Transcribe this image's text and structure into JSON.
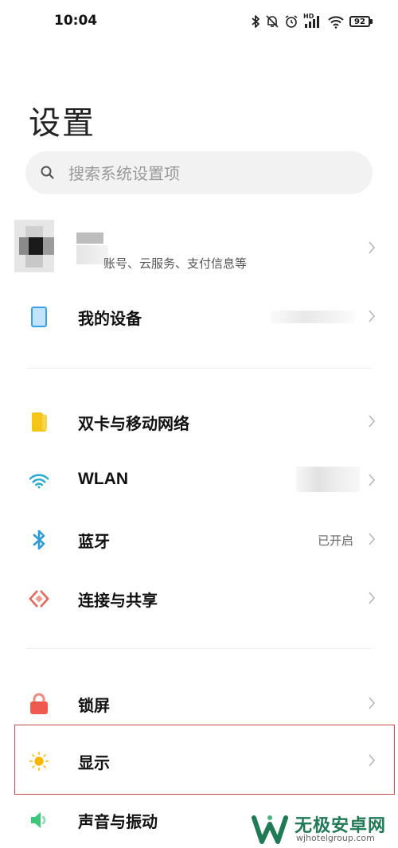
{
  "status_bar": {
    "time": "10:04",
    "battery": "92",
    "hd_label": "HD",
    "icons": [
      "bluetooth-icon",
      "mute-bell-icon",
      "alarm-icon",
      "hd-signal-icon",
      "wifi-icon",
      "battery-icon"
    ]
  },
  "page": {
    "title": "设置"
  },
  "search": {
    "placeholder": "搜索系统设置项",
    "value": ""
  },
  "account": {
    "subtitle": "账号、云服务、支付信息等"
  },
  "sections": {
    "device": {
      "label": "我的设备"
    },
    "sim": {
      "label": "双卡与移动网络"
    },
    "wlan": {
      "label": "WLAN"
    },
    "bluetooth": {
      "label": "蓝牙",
      "value": "已开启"
    },
    "connect": {
      "label": "连接与共享"
    },
    "lock": {
      "label": "锁屏"
    },
    "display": {
      "label": "显示"
    },
    "sound": {
      "label": "声音与振动"
    }
  },
  "watermark": {
    "title": "无极安卓网",
    "url": "wjhotelgroup.com"
  },
  "colors": {
    "device_icon": "#3ba0e8",
    "sim_icon": "#f5c518",
    "wlan_icon": "#27a8d6",
    "bluetooth_icon": "#2f9ad8",
    "connect_icon": "#e6685a",
    "lock_icon": "#ef5a50",
    "display_icon": "#f7b500",
    "sound_icon": "#3cc77a",
    "highlight": "#c94a4a",
    "watermark": "#1f7a55"
  }
}
